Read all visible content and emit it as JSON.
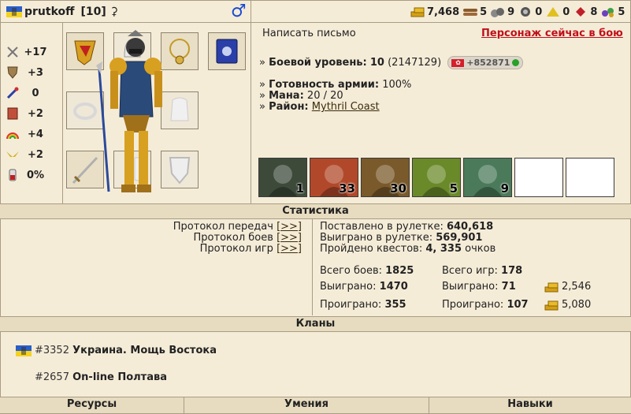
{
  "header": {
    "name": "prutkoff",
    "level": "[10]",
    "gender_icon": "male-icon",
    "resources": [
      {
        "icon": "gold-icon",
        "value": "7,468",
        "color": "#d4a017"
      },
      {
        "icon": "wood-icon",
        "value": "5",
        "color": "#8b5a2b"
      },
      {
        "icon": "ore-icon",
        "value": "9",
        "color": "#777777"
      },
      {
        "icon": "mercury-icon",
        "value": "0",
        "color": "#555555"
      },
      {
        "icon": "sulfur-icon",
        "value": "0",
        "color": "#e0c020"
      },
      {
        "icon": "crystal-icon",
        "value": "8",
        "color": "#c0202a"
      },
      {
        "icon": "gems-icon",
        "value": "5",
        "color": "#6c3fc0"
      }
    ]
  },
  "stats": [
    {
      "icon": "attack-sword-icon",
      "value": "+17"
    },
    {
      "icon": "defense-shield-icon",
      "value": "+3"
    },
    {
      "icon": "spellpower-wand-icon",
      "value": "0"
    },
    {
      "icon": "knowledge-book-icon",
      "value": "+2"
    },
    {
      "icon": "luck-rainbow-icon",
      "value": "+4"
    },
    {
      "icon": "morale-wings-icon",
      "value": "+2"
    },
    {
      "icon": "health-potion-icon",
      "value": "0%"
    }
  ],
  "info": {
    "write_letter": "Написать письмо",
    "in_battle": "Персонаж сейчас в бою",
    "combat_level_label": "Боевой уровень:",
    "combat_level_value": "10",
    "combat_level_exp": "(2147129)",
    "exp_badge": "+852871",
    "army_ready_label": "Готовность армии:",
    "army_ready_value": "100%",
    "mana_label": "Мана:",
    "mana_value": "20 / 20",
    "district_label": "Район:",
    "district_value": "Mythril Coast",
    "bullet": "»"
  },
  "army": [
    {
      "name": "assassin",
      "count": "1",
      "color": "#3d4a3a"
    },
    {
      "name": "druid",
      "count": "33",
      "color": "#b2482a"
    },
    {
      "name": "ogre",
      "count": "30",
      "color": "#7a5a2a"
    },
    {
      "name": "raptor",
      "count": "5",
      "color": "#6a8a2a"
    },
    {
      "name": "hydra",
      "count": "9",
      "color": "#4a7a5a"
    },
    {
      "name": "",
      "count": ""
    },
    {
      "name": "",
      "count": ""
    }
  ],
  "statistics": {
    "title": "Статистика",
    "protocols": [
      {
        "label": "Протокол передач",
        "link": "[>>]"
      },
      {
        "label": "Протокол боев",
        "link": "[>>]"
      },
      {
        "label": "Протокол игр",
        "link": "[>>]"
      }
    ],
    "roulette_bet_label": "Поставлено в рулетке:",
    "roulette_bet_value": "640,618",
    "roulette_won_label": "Выиграно в рулетке:",
    "roulette_won_value": "569,901",
    "quests_label": "Пройдено квестов:",
    "quests_value": "4, 335",
    "quests_unit": "очков",
    "battles_total_label": "Всего боев:",
    "battles_total_value": "1825",
    "battles_won_label": "Выиграно:",
    "battles_won_value": "1470",
    "battles_lost_label": "Проиграно:",
    "battles_lost_value": "355",
    "games_total_label": "Всего игр:",
    "games_total_value": "178",
    "games_won_label": "Выиграно:",
    "games_won_value": "71",
    "games_lost_label": "Проиграно:",
    "games_lost_value": "107",
    "games_won_gold": "2,546",
    "games_lost_gold": "5,080"
  },
  "clans": {
    "title": "Кланы",
    "items": [
      {
        "id": "#3352",
        "name": "Украина. Мощь Востока",
        "has_flag": true
      },
      {
        "id": "#2657",
        "name": "On-line Полтава",
        "has_flag": false
      }
    ]
  },
  "footer": {
    "resources": "Ресурсы",
    "skills": "Умения",
    "abilities": "Навыки"
  }
}
